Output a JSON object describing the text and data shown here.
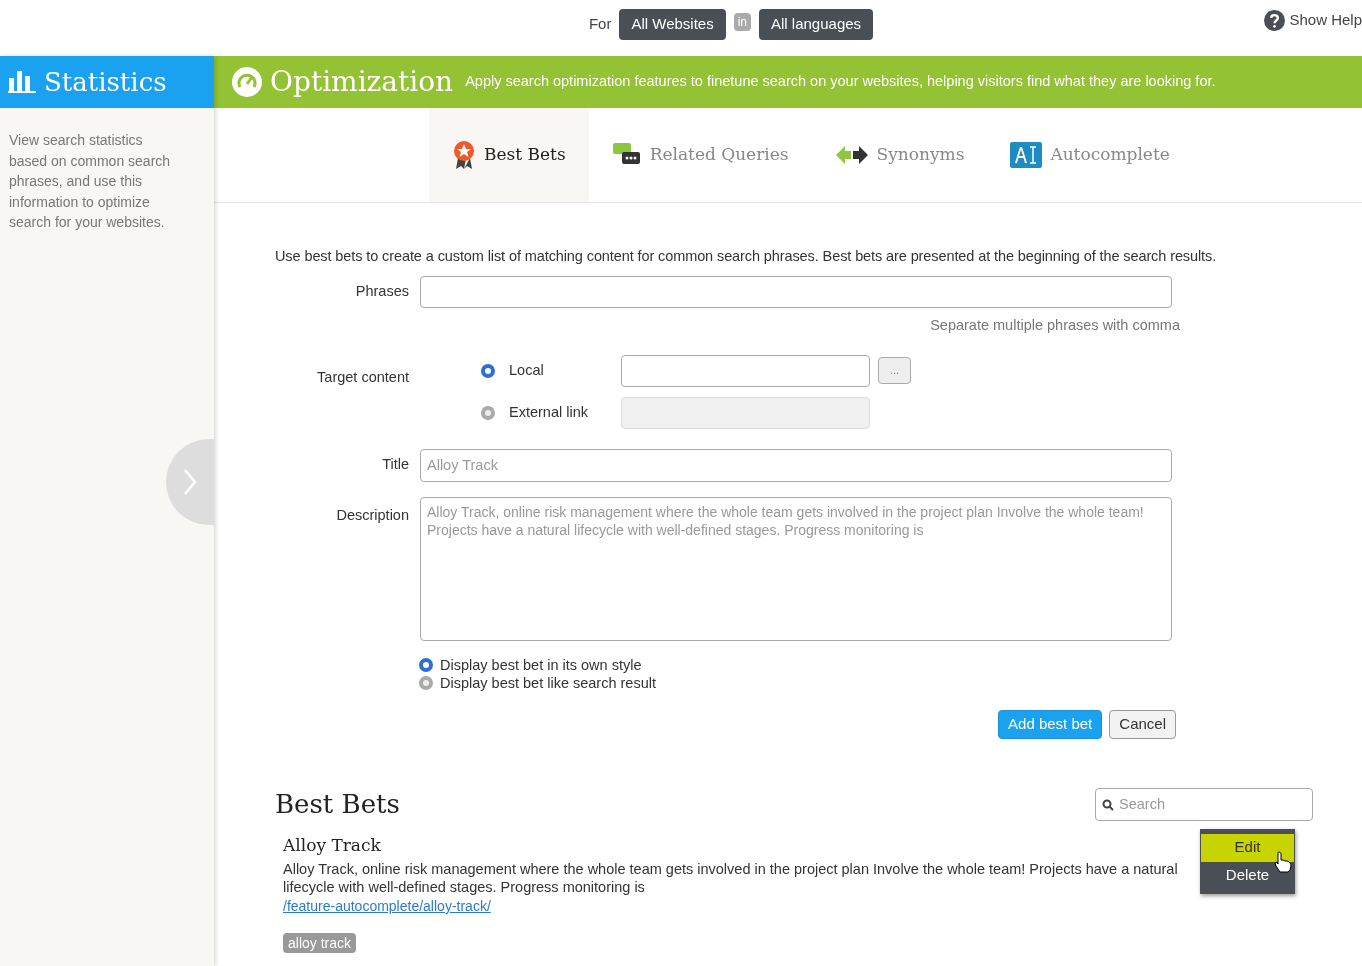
{
  "top_bar": {
    "for_label": "For",
    "site_filter": "All Websites",
    "in_label": "in",
    "language_filter": "All languages",
    "help_link": "Show Help"
  },
  "sidebar": {
    "title": "Statistics",
    "description": "View search statistics based on common search phrases, and use this information to optimize search for your websites."
  },
  "header": {
    "title": "Optimization",
    "subtitle": "Apply search optimization features to finetune search on your websites, helping visitors find what they are looking for."
  },
  "tabs": [
    {
      "label": "Best Bets",
      "kind": "ribbon",
      "selected": true
    },
    {
      "label": "Related Queries",
      "kind": "chat",
      "selected": false
    },
    {
      "label": "Synonyms",
      "kind": "arrows",
      "selected": false
    },
    {
      "label": "Autocomplete",
      "kind": "cursor",
      "selected": false
    }
  ],
  "form": {
    "intro": "Use best bets to create a custom list of matching content for common search phrases. Best bets are presented at the beginning of the search results.",
    "phrases_label": "Phrases",
    "phrases_hint": "Separate multiple phrases with comma",
    "target_label": "Target content",
    "targets": [
      {
        "label": "Local",
        "selected": true,
        "disabled": false,
        "browse": "..."
      },
      {
        "label": "External link",
        "selected": false,
        "disabled": true
      }
    ],
    "title_label": "Title",
    "title_placeholder": "Alloy Track",
    "description_label": "Description",
    "description_placeholder": "Alloy Track, online risk management where the whole team gets involved in the project plan Involve the whole team! Projects have a natural lifecycle with well-defined stages. Progress monitoring is",
    "display_options": [
      {
        "label": "Display best bet in its own style",
        "selected": true
      },
      {
        "label": "Display best bet like search result",
        "selected": false
      }
    ],
    "buttons": [
      {
        "label": "Add best bet",
        "kind": "primary"
      },
      {
        "label": "Cancel",
        "kind": "secondary"
      }
    ]
  },
  "list": {
    "title": "Best Bets",
    "search_placeholder": "Search",
    "items": [
      {
        "title": "Alloy Track",
        "description": "Alloy Track, online risk management where the whole team gets involved in the project plan Involve the whole team! Projects have a natural lifecycle with well-defined stages. Progress monitoring is",
        "url": "/feature-autocomplete/alloy-track/",
        "tags": [
          "alloy track"
        ],
        "menu": [
          {
            "label": "Edit",
            "selected": true
          },
          {
            "label": "Delete",
            "selected": false
          }
        ]
      }
    ]
  }
}
